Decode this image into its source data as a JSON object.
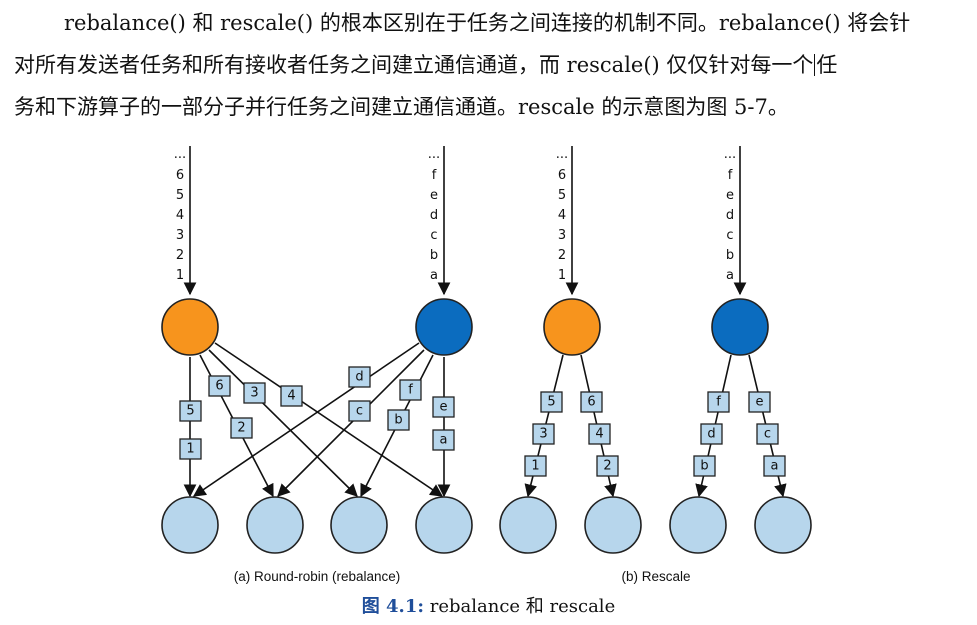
{
  "paragraph": {
    "line1": "rebalance() 和 rescale() 的根本区别在于任务之间连接的机制不同。rebalance() 将会针",
    "line2a": "对所有发送者任务和所有接收者任务之间建立通信通道，而 rescale() 仅仅针对每一个",
    "line2b": "任",
    "line3": "务和下游算子的一部分子并行任务之间建立通信通道。rescale 的示意图为图 5-7。"
  },
  "diagram": {
    "caption_a": "(a) Round-robin (rebalance)",
    "caption_b": "(b) Rescale",
    "colors": {
      "orange": "#f7941d",
      "blue": "#0b6cbf",
      "light": "#b7d6ec"
    },
    "streams": [
      {
        "id": "a_num",
        "items": [
          "...",
          "6",
          "5",
          "4",
          "3",
          "2",
          "1"
        ]
      },
      {
        "id": "a_let",
        "items": [
          "...",
          "f",
          "e",
          "d",
          "c",
          "b",
          "a"
        ]
      },
      {
        "id": "b_num",
        "items": [
          "...",
          "6",
          "5",
          "4",
          "3",
          "2",
          "1"
        ]
      },
      {
        "id": "b_let",
        "items": [
          "...",
          "f",
          "e",
          "d",
          "c",
          "b",
          "a"
        ]
      }
    ],
    "tags": {
      "a": [
        "6",
        "5",
        "1",
        "3",
        "2",
        "4",
        "d",
        "c",
        "f",
        "b",
        "e",
        "a"
      ],
      "b": [
        "5",
        "3",
        "1",
        "6",
        "4",
        "2",
        "f",
        "d",
        "b",
        "e",
        "c",
        "a"
      ]
    }
  },
  "figure_caption": {
    "label": "图 4.1:",
    "text": "rebalance 和 rescale"
  }
}
